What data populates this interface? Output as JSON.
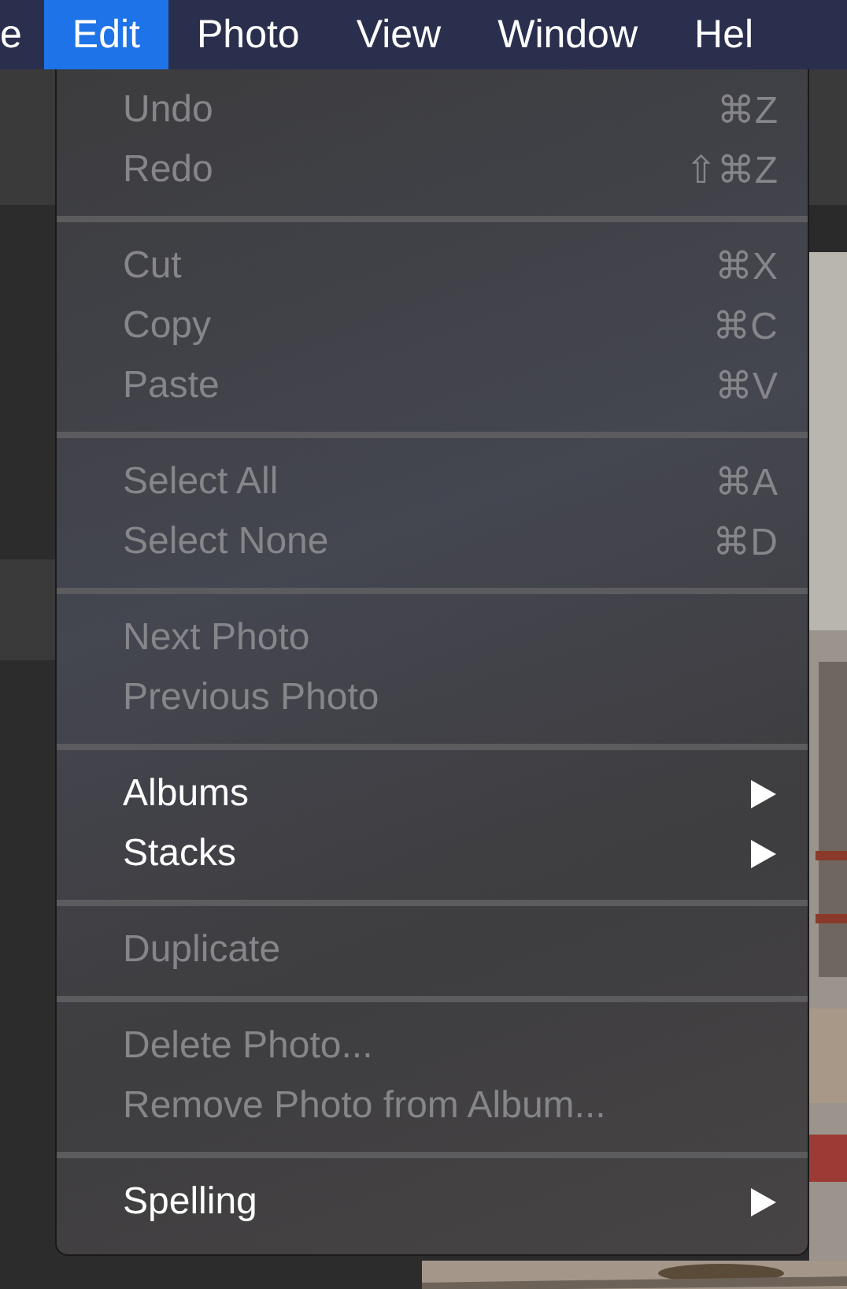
{
  "menu_bar": [
    {
      "label": "e",
      "selected": false
    },
    {
      "label": "Edit",
      "selected": true
    },
    {
      "label": "Photo",
      "selected": false
    },
    {
      "label": "View",
      "selected": false
    },
    {
      "label": "Window",
      "selected": false
    },
    {
      "label": "Hel",
      "selected": false
    }
  ],
  "menu": {
    "groups": [
      [
        {
          "label": "Undo",
          "shortcut": "⌘Z",
          "disabled": true,
          "submenu": false
        },
        {
          "label": "Redo",
          "shortcut": "⇧⌘Z",
          "disabled": true,
          "submenu": false
        }
      ],
      [
        {
          "label": "Cut",
          "shortcut": "⌘X",
          "disabled": true,
          "submenu": false
        },
        {
          "label": "Copy",
          "shortcut": "⌘C",
          "disabled": true,
          "submenu": false
        },
        {
          "label": "Paste",
          "shortcut": "⌘V",
          "disabled": true,
          "submenu": false
        }
      ],
      [
        {
          "label": "Select All",
          "shortcut": "⌘A",
          "disabled": true,
          "submenu": false
        },
        {
          "label": "Select None",
          "shortcut": "⌘D",
          "disabled": true,
          "submenu": false
        }
      ],
      [
        {
          "label": "Next Photo",
          "disabled": true,
          "submenu": false
        },
        {
          "label": "Previous Photo",
          "disabled": true,
          "submenu": false
        }
      ],
      [
        {
          "label": "Albums",
          "disabled": false,
          "submenu": true
        },
        {
          "label": "Stacks",
          "disabled": false,
          "submenu": true
        }
      ],
      [
        {
          "label": "Duplicate",
          "disabled": true,
          "submenu": false
        }
      ],
      [
        {
          "label": "Delete Photo...",
          "disabled": true,
          "submenu": false
        },
        {
          "label": "Remove Photo from Album...",
          "disabled": true,
          "submenu": false
        }
      ],
      [
        {
          "label": "Spelling",
          "disabled": false,
          "submenu": true
        }
      ]
    ]
  }
}
